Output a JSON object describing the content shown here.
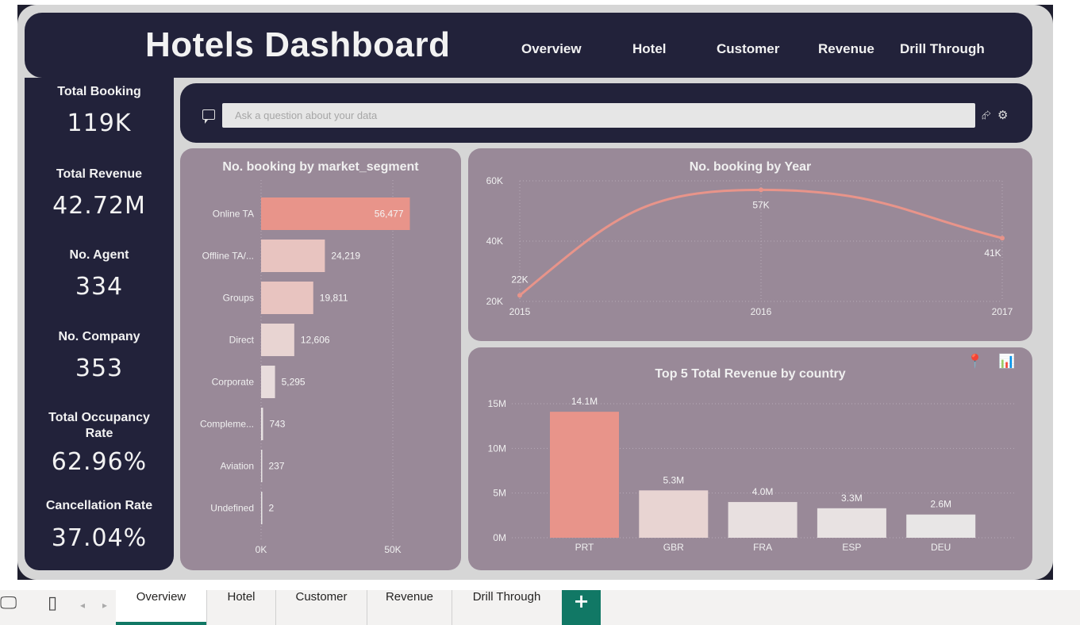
{
  "header": {
    "title": "Hotels Dashboard",
    "nav": [
      "Overview",
      "Hotel",
      "Customer",
      "Revenue",
      "Drill Through"
    ]
  },
  "kpis": [
    {
      "label": "Total Booking",
      "value": "119K"
    },
    {
      "label": "Total Revenue",
      "value": "42.72M"
    },
    {
      "label": "No. Agent",
      "value": "334"
    },
    {
      "label": "No. Company",
      "value": "353"
    },
    {
      "label": "Total Occupancy Rate",
      "value": "62.96%"
    },
    {
      "label": "Cancellation Rate",
      "value": "37.04%"
    }
  ],
  "qa": {
    "placeholder": "Ask a question about your data"
  },
  "chart_data": [
    {
      "type": "bar",
      "orientation": "horizontal",
      "title": "No. booking by market_segment",
      "categories": [
        "Online TA",
        "Offline TA/...",
        "Groups",
        "Direct",
        "Corporate",
        "Compleme...",
        "Aviation",
        "Undefined"
      ],
      "values": [
        56477,
        24219,
        19811,
        12606,
        5295,
        743,
        237,
        2
      ],
      "value_labels": [
        "56,477",
        "24,219",
        "19,811",
        "12,606",
        "5,295",
        "743",
        "237",
        "2"
      ],
      "xticks": [
        "0K",
        "50K"
      ],
      "xlim": [
        0,
        60000
      ],
      "grid": true,
      "colors": [
        "#e8948a",
        "#e8c4c0",
        "#e8c4c0",
        "#e8d4d2",
        "#e8dcdc",
        "#e8e2e2",
        "#e8e4e4",
        "#e8e6e6"
      ]
    },
    {
      "type": "line",
      "title": "No. booking by Year",
      "x": [
        2015,
        2016,
        2017
      ],
      "values": [
        22000,
        57000,
        41000
      ],
      "value_labels": [
        "22K",
        "57K",
        "41K"
      ],
      "yticks": [
        "20K",
        "40K",
        "60K"
      ],
      "ylim": [
        20000,
        60000
      ],
      "grid": true,
      "color": "#e8948a"
    },
    {
      "type": "bar",
      "title": "Top 5 Total Revenue by country",
      "categories": [
        "PRT",
        "GBR",
        "FRA",
        "ESP",
        "DEU"
      ],
      "values": [
        14.1,
        5.3,
        4.0,
        3.3,
        2.6
      ],
      "value_labels": [
        "14.1M",
        "5.3M",
        "4.0M",
        "3.3M",
        "2.6M"
      ],
      "yticks": [
        "0M",
        "5M",
        "10M",
        "15M"
      ],
      "ylim": [
        0,
        15
      ],
      "grid": true,
      "colors": [
        "#e8948a",
        "#e8d4d2",
        "#e8e0e0",
        "#e8e2e2",
        "#e8e6e6"
      ]
    }
  ],
  "tabs": {
    "items": [
      "Overview",
      "Hotel",
      "Customer",
      "Revenue",
      "Drill Through"
    ],
    "active": "Overview",
    "add": "+"
  },
  "colors": {
    "dark_panel": "#22223a",
    "chart_panel": "#998998",
    "accent": "#e8948a",
    "tab_accent": "#117865"
  }
}
